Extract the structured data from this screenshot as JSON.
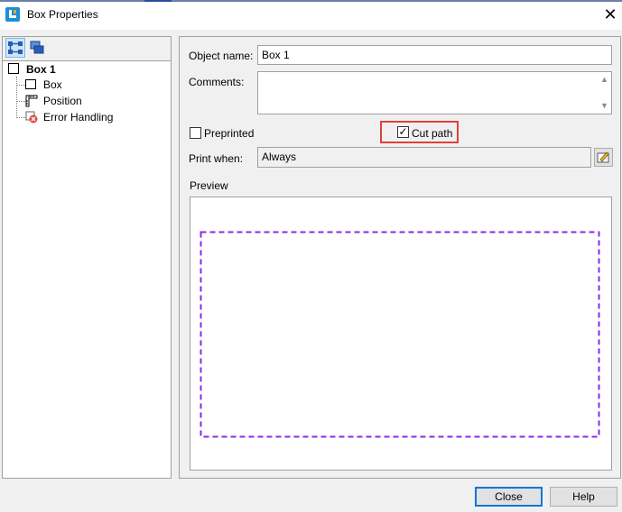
{
  "window": {
    "title": "Box Properties"
  },
  "tree": {
    "root": "Box 1",
    "children": [
      "Box",
      "Position",
      "Error Handling"
    ]
  },
  "form": {
    "object_name_label": "Object name:",
    "object_name_value": "Box 1",
    "comments_label": "Comments:",
    "comments_value": "",
    "preprinted_label": "Preprinted",
    "preprinted_checked": false,
    "cut_path_label": "Cut path",
    "cut_path_checked": true,
    "print_when_label": "Print when:",
    "print_when_value": "Always",
    "preview_label": "Preview"
  },
  "buttons": {
    "close": "Close",
    "help": "Help"
  },
  "colors": {
    "preview_outline": "#8a2be2",
    "highlight": "#e0403c",
    "default_button": "#0078d7"
  }
}
